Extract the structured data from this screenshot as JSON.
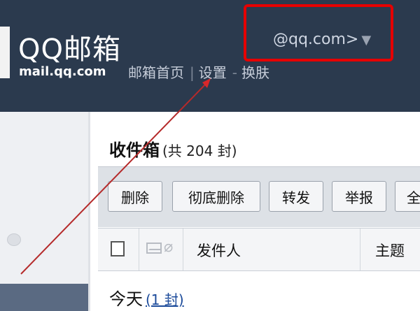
{
  "header": {
    "logo_title": "QQ邮箱",
    "logo_sub": "mail.qq.com",
    "nav": [
      "邮箱首页",
      "设置",
      "换肤"
    ],
    "account_label": "@qq.com>",
    "account_caret": "▼"
  },
  "inbox": {
    "title": "收件箱",
    "count": "(共 204 封)"
  },
  "toolbar": [
    "删除",
    "彻底删除",
    "转发",
    "举报",
    "全"
  ],
  "columns": {
    "sender": "发件人",
    "subject": "主题"
  },
  "group": {
    "label": "今天",
    "count": "(1 封)"
  },
  "colors": {
    "header_bg": "#2b3a4e",
    "highlight": "#e60000"
  }
}
